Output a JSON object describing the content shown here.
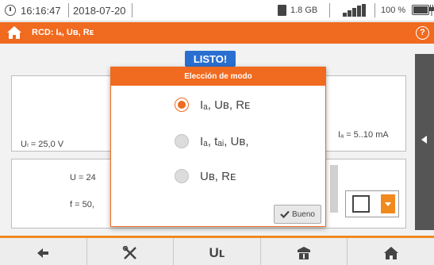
{
  "status": {
    "time": "16:16:47",
    "date": "2018-07-20",
    "memory": "1.8 GB",
    "battery": "100 %"
  },
  "header": {
    "title": "RCD: Iₐ, Uʙ, Rᴇ",
    "accent": "#f06a1f"
  },
  "background": {
    "status_label": "LISTO!",
    "ul_value": "Uₗ = 25,0 V",
    "ia_range": "Iₐ = 5..10 mA",
    "u_value": "U = 24",
    "f_value": "f = 50,"
  },
  "dialog": {
    "title": "Elección de modo",
    "options": [
      {
        "label": "Iₐ, Uʙ, Rᴇ",
        "selected": true
      },
      {
        "label": "Iₐ, tₐᵢ, Uʙ,",
        "selected": false
      },
      {
        "label": "Uʙ, Rᴇ",
        "selected": false
      }
    ],
    "ok_label": "Bueno"
  },
  "toolbar": {
    "ul_label": "Uʟ"
  }
}
